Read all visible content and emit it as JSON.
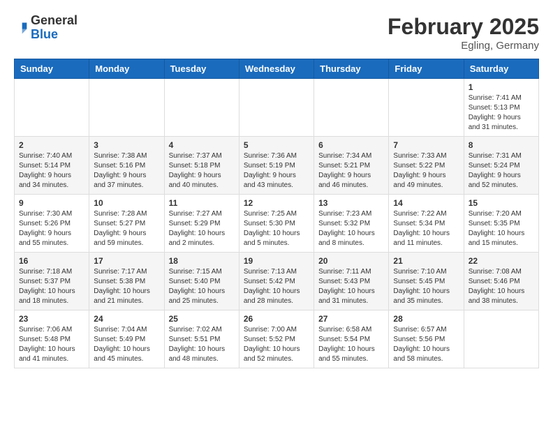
{
  "header": {
    "logo_general": "General",
    "logo_blue": "Blue",
    "month_year": "February 2025",
    "location": "Egling, Germany"
  },
  "days_of_week": [
    "Sunday",
    "Monday",
    "Tuesday",
    "Wednesday",
    "Thursday",
    "Friday",
    "Saturday"
  ],
  "weeks": [
    [
      {
        "day": "",
        "info": ""
      },
      {
        "day": "",
        "info": ""
      },
      {
        "day": "",
        "info": ""
      },
      {
        "day": "",
        "info": ""
      },
      {
        "day": "",
        "info": ""
      },
      {
        "day": "",
        "info": ""
      },
      {
        "day": "1",
        "info": "Sunrise: 7:41 AM\nSunset: 5:13 PM\nDaylight: 9 hours and 31 minutes."
      }
    ],
    [
      {
        "day": "2",
        "info": "Sunrise: 7:40 AM\nSunset: 5:14 PM\nDaylight: 9 hours and 34 minutes."
      },
      {
        "day": "3",
        "info": "Sunrise: 7:38 AM\nSunset: 5:16 PM\nDaylight: 9 hours and 37 minutes."
      },
      {
        "day": "4",
        "info": "Sunrise: 7:37 AM\nSunset: 5:18 PM\nDaylight: 9 hours and 40 minutes."
      },
      {
        "day": "5",
        "info": "Sunrise: 7:36 AM\nSunset: 5:19 PM\nDaylight: 9 hours and 43 minutes."
      },
      {
        "day": "6",
        "info": "Sunrise: 7:34 AM\nSunset: 5:21 PM\nDaylight: 9 hours and 46 minutes."
      },
      {
        "day": "7",
        "info": "Sunrise: 7:33 AM\nSunset: 5:22 PM\nDaylight: 9 hours and 49 minutes."
      },
      {
        "day": "8",
        "info": "Sunrise: 7:31 AM\nSunset: 5:24 PM\nDaylight: 9 hours and 52 minutes."
      }
    ],
    [
      {
        "day": "9",
        "info": "Sunrise: 7:30 AM\nSunset: 5:26 PM\nDaylight: 9 hours and 55 minutes."
      },
      {
        "day": "10",
        "info": "Sunrise: 7:28 AM\nSunset: 5:27 PM\nDaylight: 9 hours and 59 minutes."
      },
      {
        "day": "11",
        "info": "Sunrise: 7:27 AM\nSunset: 5:29 PM\nDaylight: 10 hours and 2 minutes."
      },
      {
        "day": "12",
        "info": "Sunrise: 7:25 AM\nSunset: 5:30 PM\nDaylight: 10 hours and 5 minutes."
      },
      {
        "day": "13",
        "info": "Sunrise: 7:23 AM\nSunset: 5:32 PM\nDaylight: 10 hours and 8 minutes."
      },
      {
        "day": "14",
        "info": "Sunrise: 7:22 AM\nSunset: 5:34 PM\nDaylight: 10 hours and 11 minutes."
      },
      {
        "day": "15",
        "info": "Sunrise: 7:20 AM\nSunset: 5:35 PM\nDaylight: 10 hours and 15 minutes."
      }
    ],
    [
      {
        "day": "16",
        "info": "Sunrise: 7:18 AM\nSunset: 5:37 PM\nDaylight: 10 hours and 18 minutes."
      },
      {
        "day": "17",
        "info": "Sunrise: 7:17 AM\nSunset: 5:38 PM\nDaylight: 10 hours and 21 minutes."
      },
      {
        "day": "18",
        "info": "Sunrise: 7:15 AM\nSunset: 5:40 PM\nDaylight: 10 hours and 25 minutes."
      },
      {
        "day": "19",
        "info": "Sunrise: 7:13 AM\nSunset: 5:42 PM\nDaylight: 10 hours and 28 minutes."
      },
      {
        "day": "20",
        "info": "Sunrise: 7:11 AM\nSunset: 5:43 PM\nDaylight: 10 hours and 31 minutes."
      },
      {
        "day": "21",
        "info": "Sunrise: 7:10 AM\nSunset: 5:45 PM\nDaylight: 10 hours and 35 minutes."
      },
      {
        "day": "22",
        "info": "Sunrise: 7:08 AM\nSunset: 5:46 PM\nDaylight: 10 hours and 38 minutes."
      }
    ],
    [
      {
        "day": "23",
        "info": "Sunrise: 7:06 AM\nSunset: 5:48 PM\nDaylight: 10 hours and 41 minutes."
      },
      {
        "day": "24",
        "info": "Sunrise: 7:04 AM\nSunset: 5:49 PM\nDaylight: 10 hours and 45 minutes."
      },
      {
        "day": "25",
        "info": "Sunrise: 7:02 AM\nSunset: 5:51 PM\nDaylight: 10 hours and 48 minutes."
      },
      {
        "day": "26",
        "info": "Sunrise: 7:00 AM\nSunset: 5:52 PM\nDaylight: 10 hours and 52 minutes."
      },
      {
        "day": "27",
        "info": "Sunrise: 6:58 AM\nSunset: 5:54 PM\nDaylight: 10 hours and 55 minutes."
      },
      {
        "day": "28",
        "info": "Sunrise: 6:57 AM\nSunset: 5:56 PM\nDaylight: 10 hours and 58 minutes."
      },
      {
        "day": "",
        "info": ""
      }
    ]
  ]
}
